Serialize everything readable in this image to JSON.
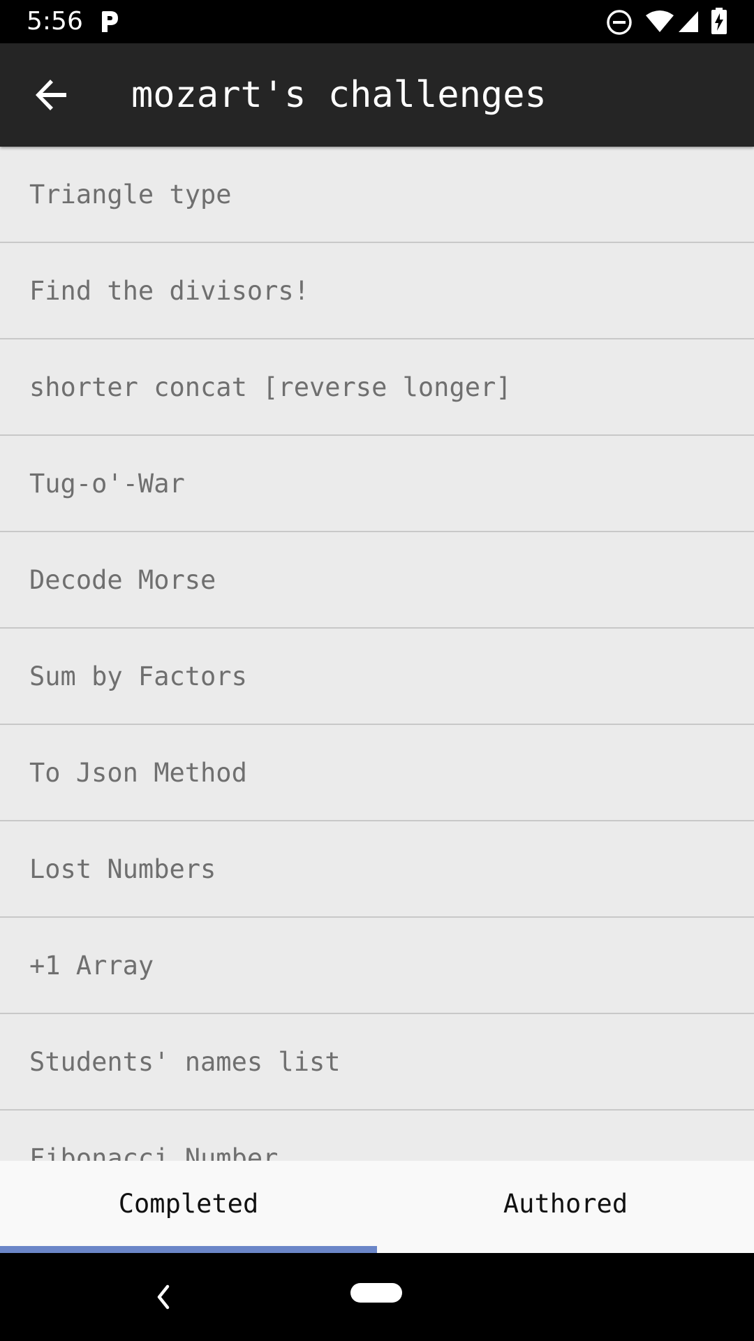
{
  "status_bar": {
    "time": "5:56",
    "icons": [
      "parking-icon",
      "do-not-disturb-icon",
      "wifi-icon",
      "signal-icon",
      "battery-charging-icon"
    ]
  },
  "app_bar": {
    "title": "mozart's challenges",
    "back_icon": "arrow-back-icon"
  },
  "challenges": [
    "Triangle type",
    "Find the divisors!",
    "shorter concat [reverse longer]",
    "Tug-o'-War",
    "Decode Morse",
    "Sum by Factors",
    "To Json Method",
    "Lost Numbers",
    "+1 Array",
    "Students' names list",
    "Fibonacci Number"
  ],
  "tabs": [
    {
      "label": "Completed",
      "selected": true
    },
    {
      "label": "Authored",
      "selected": false
    }
  ],
  "colors": {
    "app_bar": "#252525",
    "tab_indicator": "#6b86c8",
    "list_background": "#ebebeb",
    "list_text": "#6f6f6f"
  },
  "nav_bar": {
    "icons": [
      "nav-back-icon",
      "home-pill-icon"
    ]
  }
}
